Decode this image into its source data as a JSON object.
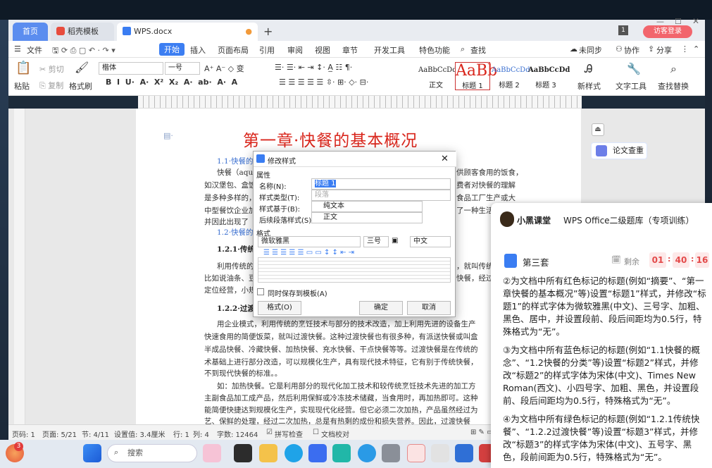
{
  "window": {
    "tabs": [
      {
        "label": "首页"
      },
      {
        "label": "稻壳模板"
      },
      {
        "label": "WPS.docx"
      }
    ],
    "visitor_login": "访客登录"
  },
  "menubar": {
    "file": "文件",
    "items": [
      "开始",
      "插入",
      "页面布局",
      "引用",
      "审阅",
      "视图",
      "章节",
      "开发工具",
      "特色功能"
    ],
    "search": "查找",
    "sync": "未同步",
    "collab": "协作",
    "share": "分享"
  },
  "toolbar": {
    "paste": "粘贴",
    "cut": "剪切",
    "copy": "复制",
    "format_painter": "格式刷",
    "font_name": "楷体",
    "font_size": "一号",
    "styles": [
      {
        "sample": "AaBbCcDd",
        "label": "正文"
      },
      {
        "sample": "AaBb",
        "label": "标题 1"
      },
      {
        "sample": "AaBbCcDd",
        "label": "标题 2"
      },
      {
        "sample": "AaBbCcDd",
        "label": "标题 3"
      }
    ],
    "new_style": "新样式",
    "text_tools": "文字工具",
    "find_replace": "查找替换"
  },
  "document": {
    "chapter_title": "第一章·快餐的基本概况",
    "lines": [
      {
        "text": "1.1·快餐的",
        "cls": "bluehead"
      },
      {
        "text": "快餐（aqui",
        "cls": ""
      },
      {
        "text": "如汉堡包、盒饭",
        "cls": ""
      },
      {
        "text": "是多种多样的，",
        "cls": ""
      },
      {
        "text": "中型餐饮企业加",
        "cls": ""
      },
      {
        "text": "并因此出现了",
        "cls": ""
      },
      {
        "text": "1.2·快餐的",
        "cls": "bluehead"
      },
      {
        "text": "1.2.1·传统",
        "cls": "greenhead"
      },
      {
        "text": "利用传统的",
        "cls": ""
      },
      {
        "text": "比如说油条、豆",
        "cls": ""
      },
      {
        "text": "定位经营，小规",
        "cls": ""
      },
      {
        "text": "1.2.2·过渡",
        "cls": "greenhead"
      },
      {
        "text": "用企业模式，利用传统的烹饪技术与部分的技术改造，加上利用先进的设备生产",
        "cls": ""
      },
      {
        "text": "快速食用的简便饭菜，就叫过渡快餐。这种过渡快餐也有很多种，有派送快餐或叫盒",
        "cls": ""
      },
      {
        "text": "半成品快餐、冷藏快餐、加热快餐、充水快餐、干点快餐等等。过渡快餐是在传统的",
        "cls": ""
      },
      {
        "text": "术基础上进行部分改造，可以规模化生产，具有现代技术特征，它有别于传统快餐，",
        "cls": ""
      },
      {
        "text": "不到现代快餐的标准。。",
        "cls": ""
      },
      {
        "text": "如：加热快餐。它是利用部分的现代化加工技术和较传统烹饪技术先进的加工方",
        "cls": ""
      },
      {
        "text": "主副食品加工成产品，然后利用保鲜或冷冻技术储藏，当食用时，再加热即可。这种",
        "cls": ""
      },
      {
        "text": "能简便快捷达到规模化生产，实现现代化经营。但它必须二次加热，产品虽然经过为",
        "cls": ""
      },
      {
        "text": "艺、保鲜的处理，经过二次加热，总是有热剩的成份和损失营养。因此，过渡快餐",
        "cls": ""
      }
    ],
    "right_fragments": [
      "供顾客食用的饭食，",
      "费者对快餐的理解",
      "食品工厂生产或大",
      "了一种生活",
      "，就叫传统",
      "快餐，经过"
    ],
    "proofread": "论文查重"
  },
  "dialog": {
    "title": "修改样式",
    "section_attr": "属性",
    "name_label": "名称(N):",
    "name_value": "标题 1",
    "type_label": "样式类型(T):",
    "type_value": "段落",
    "based_label": "样式基于(B):",
    "based_value": "纯文本",
    "next_label": "后续段落样式(S):",
    "next_value": "正文",
    "section_format": "格式",
    "font_value": "微软雅黑",
    "size_value": "三号",
    "lang_value": "中文",
    "save_template": "同时保存到模板(A)",
    "format_button": "格式(O)",
    "ok": "确定",
    "cancel": "取消"
  },
  "statusbar": {
    "page_num": "页码: 1",
    "page": "页面: 5/21",
    "section": "节: 4/11",
    "position": "设置值: 3.4厘米",
    "row": "行: 1",
    "col": "列: 4",
    "words": "字数: 12464",
    "spell": "拼写检查",
    "proof": "文档校对"
  },
  "taskbar": {
    "search": "搜索",
    "badge": "3"
  },
  "panel": {
    "brand": "小黑课堂",
    "title": "WPS Office二级题库（专项训练）",
    "set": "第三套",
    "remain": "剩余",
    "timer": [
      "01",
      "40",
      "16"
    ],
    "questions": [
      "②为文档中所有红色标记的标题(例如“摘要”、“第一章快餐的基本概况”等)设置“标题1”样式，并修改“标题1”的样式字体为微软雅黑(中文)、三号字、加粗、黑色、居中，并设置段前、段后间距均为0.5行，特殊格式为“无”。",
      "③为文档中所有蓝色标记的标题(例如“1.1快餐的概念”、“1.2快餐的分类”等)设置“标题2”样式，并修改“标题2”的样式字体为宋体(中文)、Times New Roman(西文)、小四号字、加粗、黑色，并设置段前、段后间距均为0.5行，特殊格式为“无”。",
      "④为文档中所有绿色标记的标题(例如“1.2.1传统快餐”、“1.2.2过渡快餐”等)设置“标题3”样式，并修改“标题3”的样式字体为宋体(中文)、五号字、黑色，段前间距为0.5行，特殊格式为“无”。"
    ]
  }
}
